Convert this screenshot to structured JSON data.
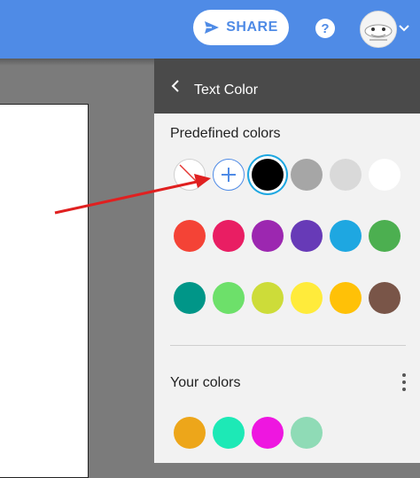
{
  "topbar": {
    "share_label": "SHARE",
    "help_icon": "question-icon",
    "accent": "#4f8be6"
  },
  "panel": {
    "title": "Text Color",
    "back_icon": "chevron-left-icon",
    "predefined_title": "Predefined colors",
    "your_colors_title": "Your colors",
    "more_icon": "more-vertical-icon"
  },
  "predefined_colors": [
    [
      "none",
      "add",
      "#000000",
      "#a6a6a6",
      "#d9d9d9",
      "#ffffff"
    ],
    [
      "#f44336",
      "#e91e63",
      "#9c27b0",
      "#673ab7",
      "#1ea7e1",
      "#4caf50"
    ],
    [
      "#009688",
      "#6de06a",
      "#cddc39",
      "#ffeb3b",
      "#ffc107",
      "#795548"
    ]
  ],
  "selected_color": "#000000",
  "your_colors": [
    "#eda61a",
    "#1de9b6",
    "#ee16e0",
    "#8fdbb6"
  ],
  "annotation": {
    "arrow_color": "#e02020",
    "points_to": "add-color-button"
  }
}
